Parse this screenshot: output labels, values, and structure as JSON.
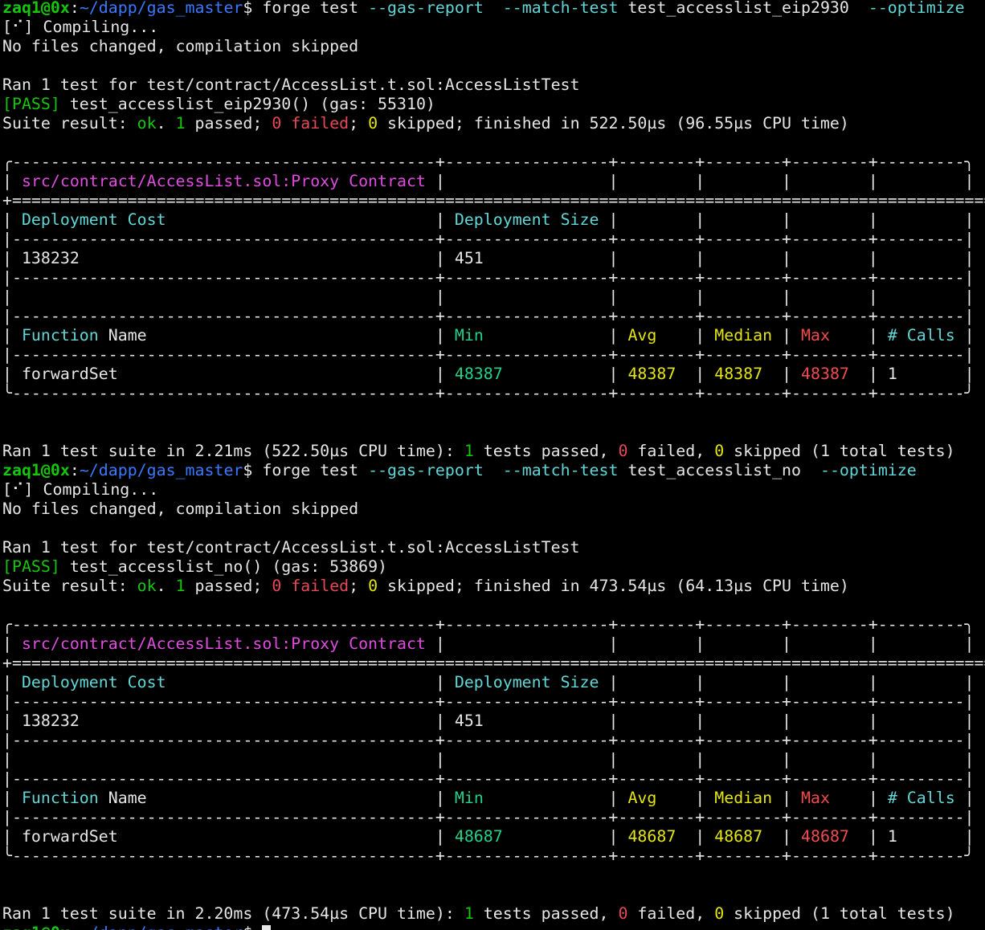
{
  "terminal": {
    "prompt": {
      "user_host": "zaq1@0x",
      "path": "~/dapp/gas_master",
      "symbol": "$"
    },
    "runs": [
      {
        "command": {
          "cmd": "forge test",
          "flag1": "--gas-report",
          "flag2": "--match-test",
          "arg": "test_accesslist_eip2930",
          "flag3": "--optimize"
        },
        "compiling": "[⠊] Compiling...",
        "no_change": "No files changed, compilation skipped",
        "ran_line": "Ran 1 test for test/contract/AccessList.t.sol:AccessListTest",
        "pass_tag": "[PASS]",
        "pass_rest": " test_accesslist_eip2930() (gas: 55310)",
        "suite": {
          "prefix": "Suite result: ",
          "ok": "ok",
          "dot": ". ",
          "passed_n": "1",
          "passed_t": " passed; ",
          "failed_n": "0",
          "failed_t": " failed",
          "sep": "; ",
          "skipped_n": "0",
          "skipped_t": " skipped; finished in 522.50µs (96.55µs CPU time)"
        },
        "table": {
          "contract": "src/contract/AccessList.sol:Proxy Contract",
          "deployment_cost_label": "Deployment Cost",
          "deployment_size_label": "Deployment Size",
          "deployment_cost": "138232",
          "deployment_size": "451",
          "function_name_label_a": "Function",
          "function_name_label_b": "Name",
          "min_label": "Min",
          "avg_label": "Avg",
          "median_label": "Median",
          "max_label": "Max",
          "calls_label": "# Calls",
          "function": "forwardSet",
          "min": "48387",
          "avg": "48387",
          "median": "48387",
          "max": "48387",
          "calls": "1"
        },
        "summary": {
          "prefix": "Ran 1 test suite in 2.21ms (522.50µs CPU time): ",
          "passed_n": "1",
          "passed_t": " tests passed, ",
          "failed_n": "0",
          "failed_t": " failed, ",
          "skipped_n": "0",
          "skipped_t": " skipped (1 total tests)"
        }
      },
      {
        "command": {
          "cmd": "forge test",
          "flag1": "--gas-report",
          "flag2": "--match-test",
          "arg": "test_accesslist_no",
          "flag3": "--optimize"
        },
        "compiling": "[⠊] Compiling...",
        "no_change": "No files changed, compilation skipped",
        "ran_line": "Ran 1 test for test/contract/AccessList.t.sol:AccessListTest",
        "pass_tag": "[PASS]",
        "pass_rest": " test_accesslist_no() (gas: 53869)",
        "suite": {
          "prefix": "Suite result: ",
          "ok": "ok",
          "dot": ". ",
          "passed_n": "1",
          "passed_t": " passed; ",
          "failed_n": "0",
          "failed_t": " failed",
          "sep": "; ",
          "skipped_n": "0",
          "skipped_t": " skipped; finished in 473.54µs (64.13µs CPU time)"
        },
        "table": {
          "contract": "src/contract/AccessList.sol:Proxy Contract",
          "deployment_cost_label": "Deployment Cost",
          "deployment_size_label": "Deployment Size",
          "deployment_cost": "138232",
          "deployment_size": "451",
          "function_name_label_a": "Function",
          "function_name_label_b": "Name",
          "min_label": "Min",
          "avg_label": "Avg",
          "median_label": "Median",
          "max_label": "Max",
          "calls_label": "# Calls",
          "function": "forwardSet",
          "min": "48687",
          "avg": "48687",
          "median": "48687",
          "max": "48687",
          "calls": "1"
        },
        "summary": {
          "prefix": "Ran 1 test suite in 2.20ms (473.54µs CPU time): ",
          "passed_n": "1",
          "passed_t": " tests passed, ",
          "failed_n": "0",
          "failed_t": " failed, ",
          "skipped_n": "0",
          "skipped_t": " skipped (1 total tests)"
        }
      }
    ],
    "colors": {
      "background": "#000000",
      "foreground": "#e6e6e6",
      "prompt_green": "#16c60c",
      "path_blue": "#3b78ff",
      "flag_cyan": "#61d6d6",
      "magenta": "#e04ce0",
      "yellow": "#e5e510",
      "red": "#f14c4c"
    }
  }
}
